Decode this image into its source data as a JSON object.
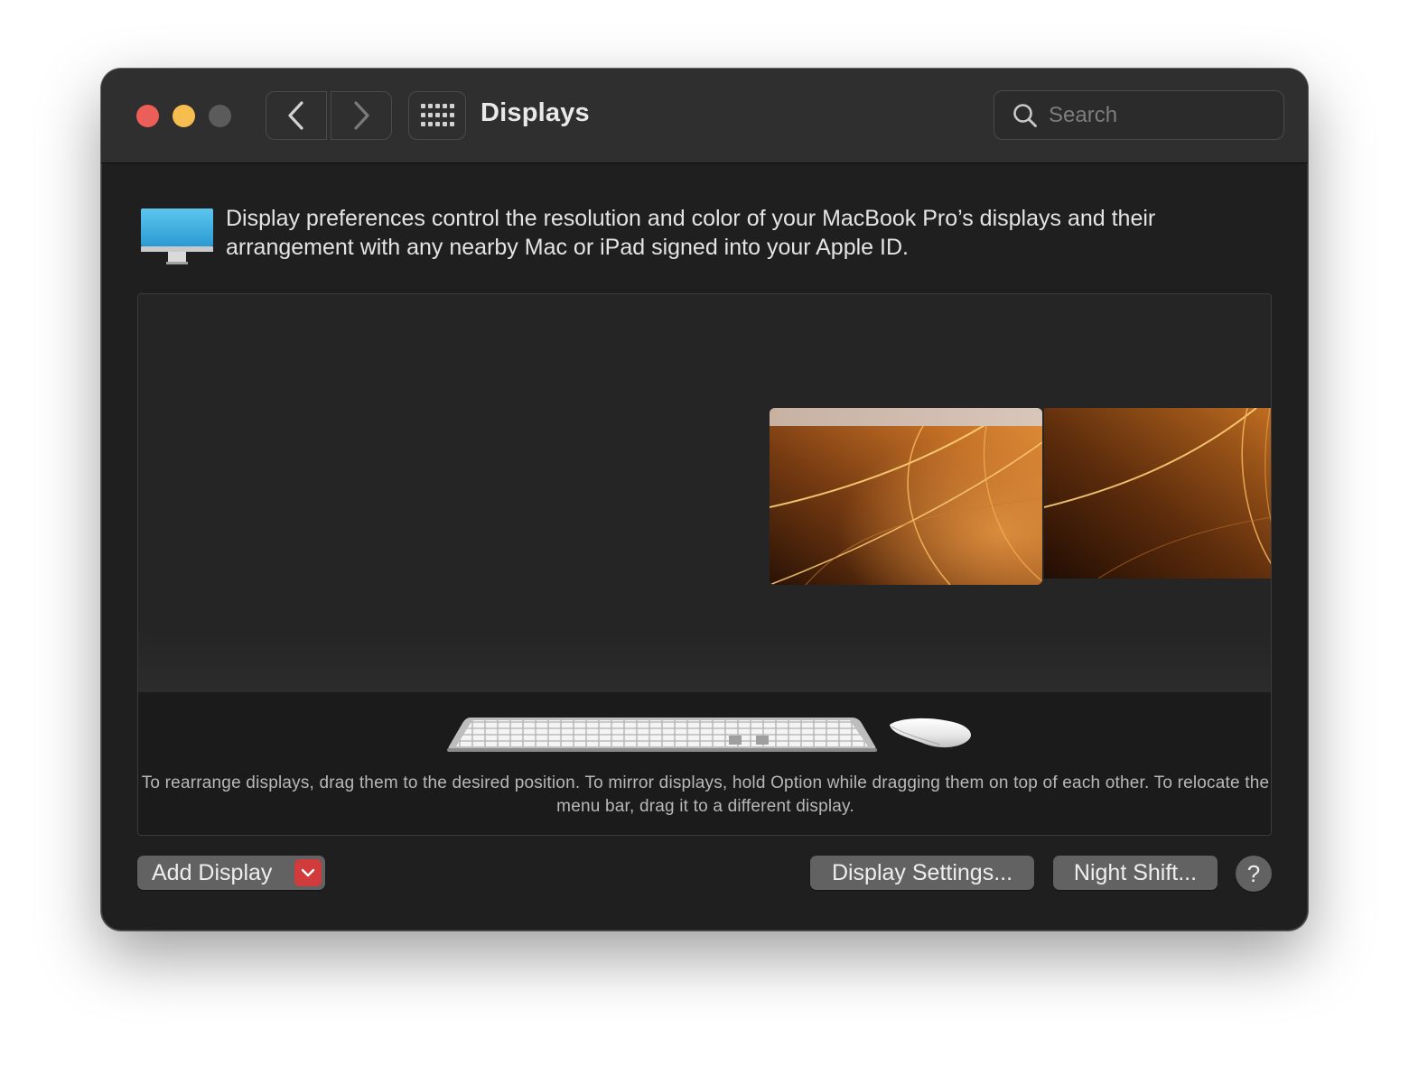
{
  "window": {
    "title": "Displays",
    "traffic_lights": {
      "close": "#ec5f58",
      "minimize": "#f5be4f",
      "zoom": "#5b5b5b"
    }
  },
  "toolbar": {
    "back_icon": "chevron-left-icon",
    "forward_icon": "chevron-right-icon",
    "show_all_icon": "grid-icon"
  },
  "search": {
    "placeholder": "Search",
    "value": ""
  },
  "header": {
    "icon": "display-icon",
    "description": "Display preferences control the resolution and color of your MacBook Pro’s displays and their arrangement with any nearby Mac or iPad signed into your Apple ID."
  },
  "arrangement": {
    "displays": [
      {
        "name": "main-display",
        "has_menu_bar": true
      },
      {
        "name": "secondary-display",
        "has_menu_bar": false
      }
    ],
    "hint": "To rearrange displays, drag them to the desired position. To mirror displays, hold Option while dragging them on top of each other. To relocate the menu bar, drag it to a different display."
  },
  "footer": {
    "add_display_label": "Add Display",
    "display_settings_label": "Display Settings...",
    "night_shift_label": "Night Shift...",
    "help_label": "?"
  },
  "colors": {
    "window_bg": "#1f1f1f",
    "titlebar_bg": "#2f2f2f",
    "button_bg": "#626262",
    "accent_red": "#d13b3b",
    "display_icon_blue": "#3fb0e2"
  }
}
